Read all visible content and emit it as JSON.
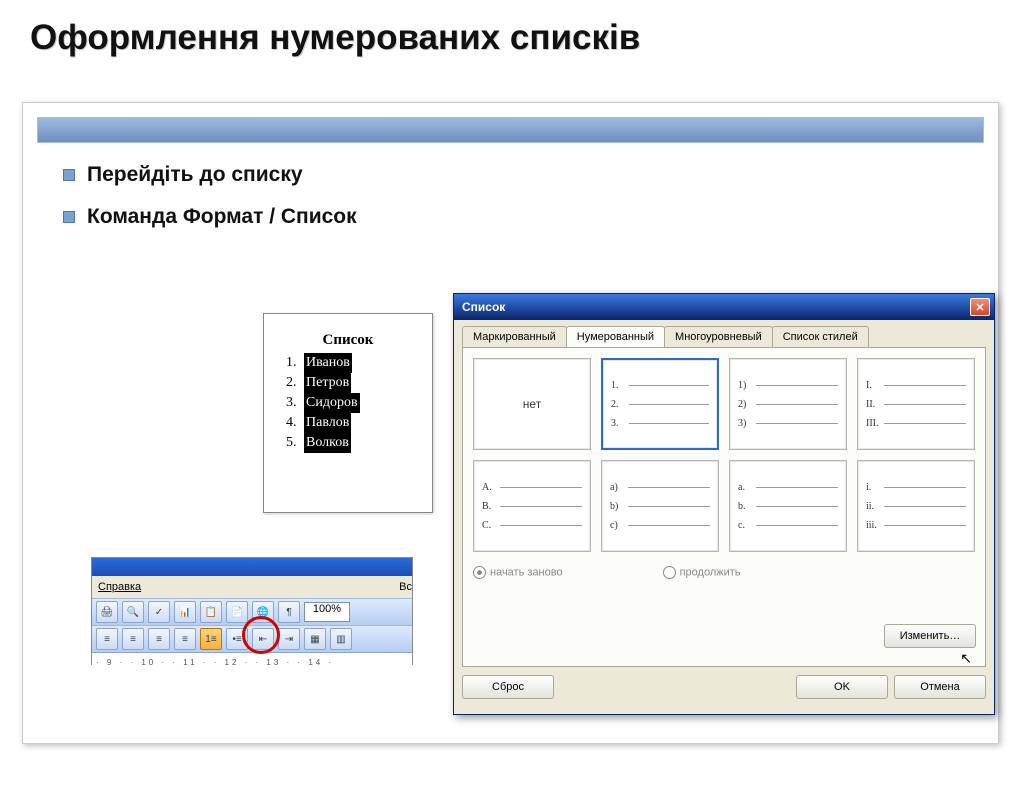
{
  "title": "Оформлення нумерованих списків",
  "bullets": {
    "b1": "Перейдіть до списку",
    "b2": "Команда Формат / Список"
  },
  "doc": {
    "heading": "Список",
    "items": [
      "Иванов",
      "Петров",
      "Сидоров",
      "Павлов",
      "Волков"
    ]
  },
  "toolbar": {
    "menu_label": "Справка",
    "menu_right": "Вс",
    "zoom": "100%",
    "ruler": "· 9 · · 10 · · 11 · · 12 · · 13 · · 14 ·"
  },
  "dialog": {
    "title": "Список",
    "tabs": {
      "bullet": "Маркированный",
      "number": "Нумерованный",
      "multi": "Многоуровневый",
      "styles": "Список стилей"
    },
    "none_label": "нет",
    "row1": [
      [
        "1.",
        "2.",
        "3."
      ],
      [
        "1)",
        "2)",
        "3)"
      ],
      [
        "I.",
        "II.",
        "III."
      ]
    ],
    "row2": [
      [
        "A.",
        "B.",
        "C."
      ],
      [
        "a)",
        "b)",
        "c)"
      ],
      [
        "a.",
        "b.",
        "c."
      ],
      [
        "i.",
        "ii.",
        "iii."
      ]
    ],
    "radios": {
      "restart": "начать заново",
      "continue": "продолжить"
    },
    "buttons": {
      "change": "Изменить…",
      "reset": "Сброс",
      "ok": "OK",
      "cancel": "Отмена"
    }
  }
}
